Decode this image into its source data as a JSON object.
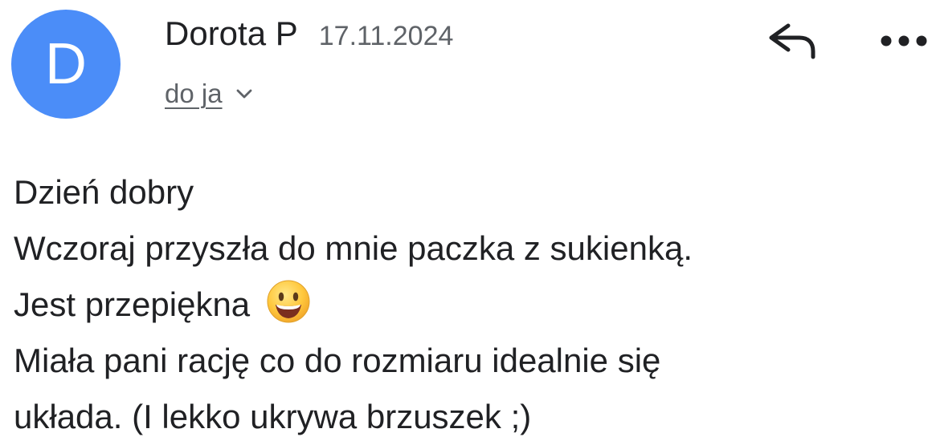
{
  "avatar": {
    "initial": "D",
    "color": "#4b8df8"
  },
  "sender": {
    "name": "Dorota P",
    "date": "17.11.2024"
  },
  "recipient": {
    "label": "do ja",
    "expand_icon": "chevron-down-icon"
  },
  "actions": {
    "reply_icon": "reply-icon",
    "more_icon": "more-options-icon"
  },
  "message": {
    "lines": [
      "Dzień dobry",
      "Wczoraj przyszła do mnie paczka z sukienką.",
      "Jest przepiękna",
      "Miała pani rację co do rozmiaru idealnie się",
      "układa. (I lekko ukrywa brzuszek ;)"
    ],
    "emoji": "grinning-face-emoji"
  },
  "colors": {
    "text_primary": "#202124",
    "text_secondary": "#5f6368",
    "emoji_face": "#ffc83d",
    "emoji_outline": "#e0a12b"
  }
}
